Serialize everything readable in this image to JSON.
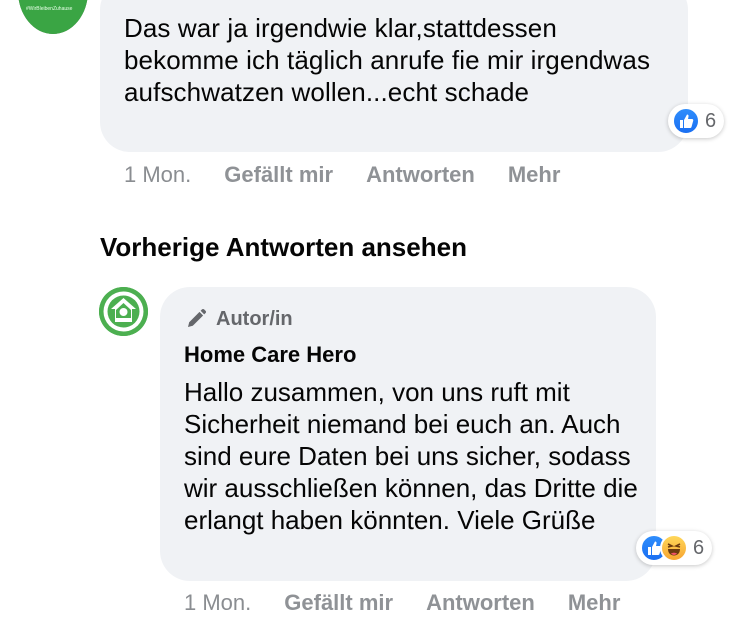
{
  "comment1": {
    "text": "Das war ja irgendwie klar,stattdessen bekomme ich täglich anrufe fie mir irgendwas aufschwatzen wollen...echt schade",
    "reaction_count": "6",
    "reaction_icons": [
      "like-icon"
    ],
    "avatar_caption": "#WirBleibenZuhause",
    "time": "1 Mon.",
    "actions": {
      "like": "Gefällt mir",
      "reply": "Antworten",
      "more": "Mehr"
    }
  },
  "view_previous_replies": "Vorherige Antworten ansehen",
  "comment2": {
    "badge": "Autor/in",
    "badge_icon": "pencil-icon",
    "author": "Home Care Hero",
    "text": "Hallo zusammen, von uns ruft mit Sicherheit niemand bei euch an. Auch sind eure Daten bei uns sicher, sodass wir ausschließen können, das Dritte die erlangt haben könnten. Viele Grüße",
    "reaction_count": "6",
    "reaction_icons": [
      "like-icon",
      "haha-icon"
    ],
    "time": "1 Mon.",
    "actions": {
      "like": "Gefällt mir",
      "reply": "Antworten",
      "more": "Mehr"
    }
  },
  "colors": {
    "bubble": "#f0f2f5",
    "like_blue": "#1a6ff2",
    "brand_green": "#4caf50",
    "meta_gray": "#8a8d91"
  }
}
